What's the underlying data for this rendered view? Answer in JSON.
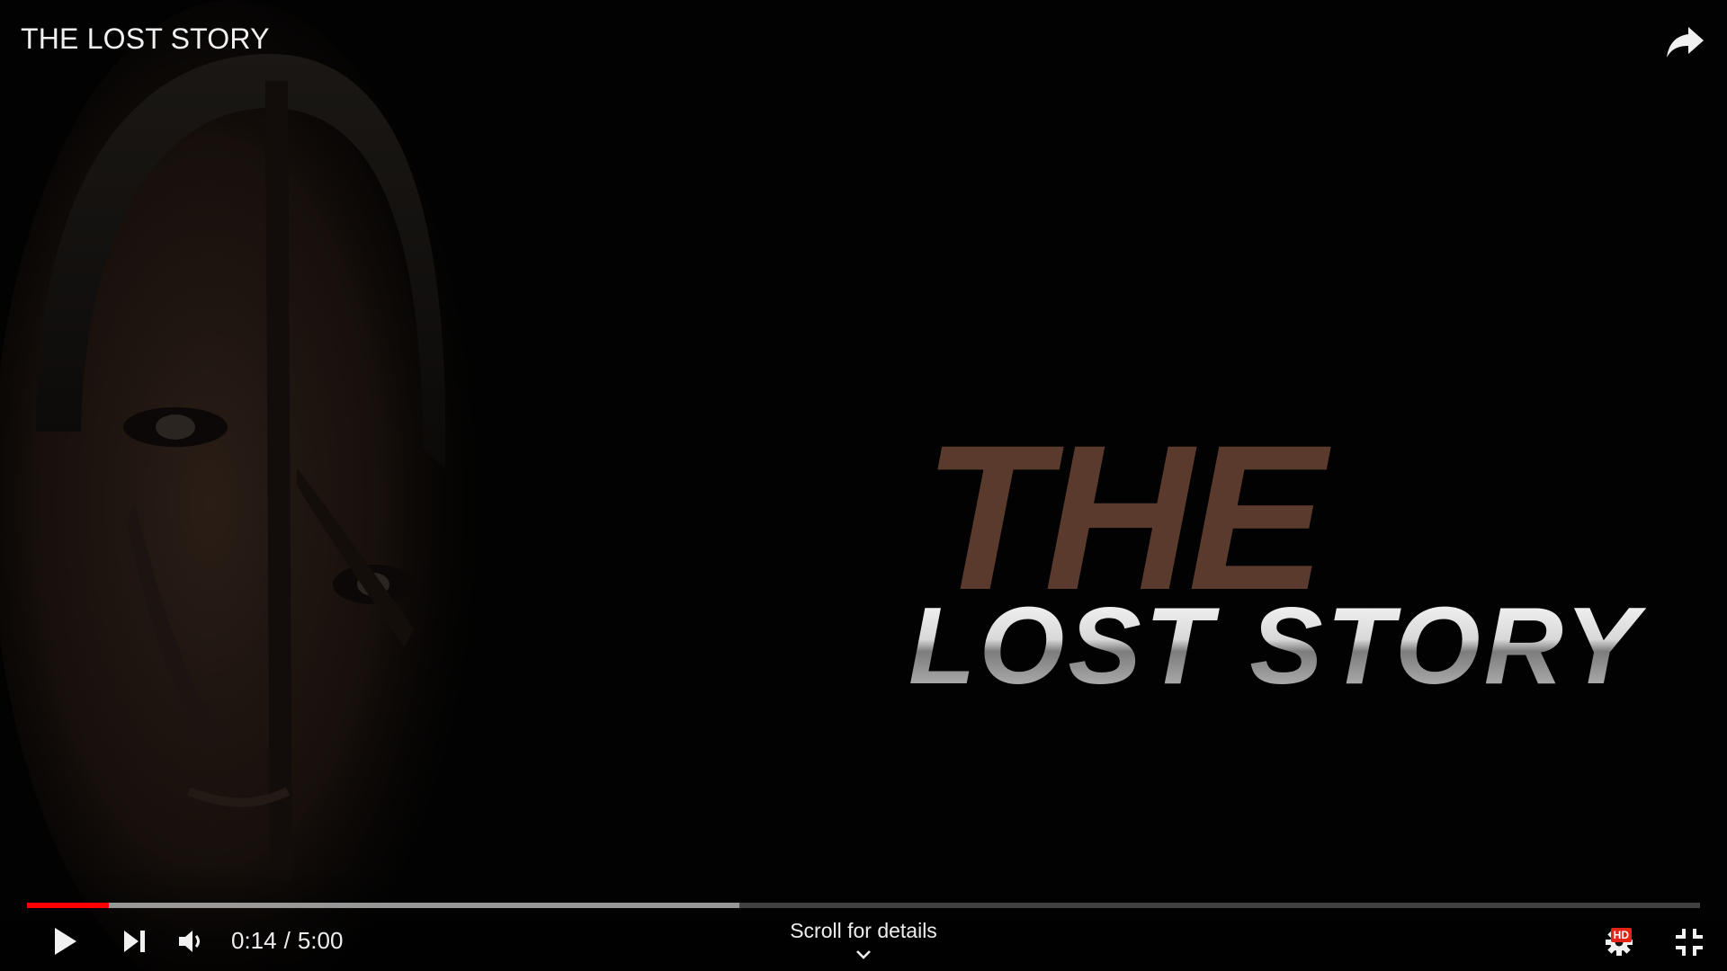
{
  "player": {
    "title": "THE LOST STORY",
    "time": {
      "current": "0:14",
      "separator": "/",
      "duration": "5:00"
    },
    "progress": {
      "played_fraction": 0.049,
      "loaded_fraction": 0.426
    },
    "scroll_hint": "Scroll for details",
    "quality_badge": "HD"
  },
  "title_art": {
    "line1": "THE",
    "line2": "LOST STORY"
  },
  "icons": {
    "share": "share-arrow-icon",
    "play": "play-icon",
    "next": "next-icon",
    "volume": "volume-icon",
    "settings": "gear-icon",
    "exit_fullscreen": "exit-fullscreen-icon",
    "scroll": "chevron-down-icon"
  },
  "colors": {
    "progress_played": "#ff0000",
    "badge": "#e62117",
    "art_the": "#5a3a2c"
  }
}
